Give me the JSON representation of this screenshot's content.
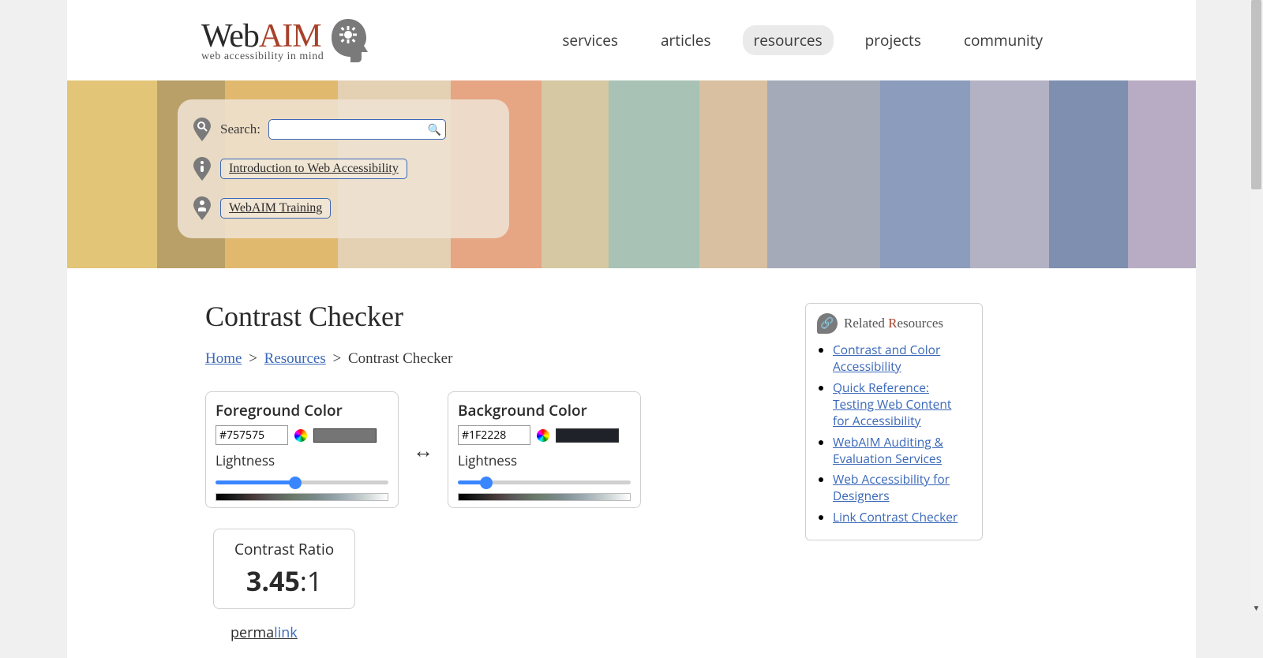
{
  "logo": {
    "web": "Web",
    "aim": "AIM",
    "tagline": "web accessibility in mind"
  },
  "nav": {
    "items": [
      {
        "label": "services",
        "active": false
      },
      {
        "label": "articles",
        "active": false
      },
      {
        "label": "resources",
        "active": true
      },
      {
        "label": "projects",
        "active": false
      },
      {
        "label": "community",
        "active": false
      }
    ]
  },
  "searchbox": {
    "label": "Search:",
    "intro_link": "Introduction to Web Accessibility",
    "training_link": "WebAIM Training"
  },
  "page_title": "Contrast Checker",
  "breadcrumb": {
    "home": "Home",
    "resources": "Resources",
    "current": "Contrast Checker"
  },
  "foreground": {
    "title": "Foreground Color",
    "hex": "#757575",
    "lightness_label": "Lightness",
    "slider_pct": 46,
    "swatch": "#757575"
  },
  "background": {
    "title": "Background Color",
    "hex": "#1F2228",
    "lightness_label": "Lightness",
    "slider_pct": 14,
    "swatch": "#1F2228"
  },
  "ratio": {
    "title": "Contrast Ratio",
    "value": "3.45",
    "suffix": ":1"
  },
  "permalink": {
    "perma": "perma",
    "link": "link"
  },
  "related": {
    "title_prefix": "Related ",
    "title_r": "R",
    "title_rest": "esources",
    "items": [
      "Contrast and Color Accessibility",
      "Quick Reference: Testing Web Content for Accessibility",
      "WebAIM Auditing & Evaluation Services",
      "Web Accessibility for Designers",
      "Link Contrast Checker"
    ]
  }
}
